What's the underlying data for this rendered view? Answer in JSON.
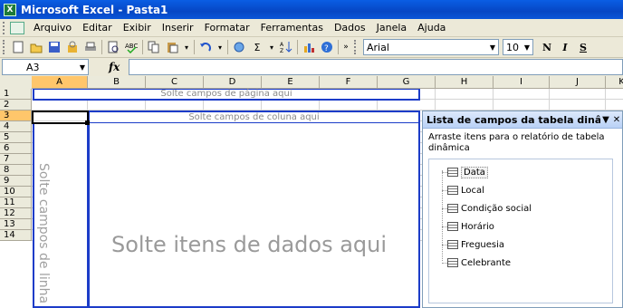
{
  "window": {
    "title": "Microsoft Excel - Pasta1"
  },
  "menubar": {
    "items": [
      {
        "label": "Arquivo"
      },
      {
        "label": "Editar"
      },
      {
        "label": "Exibir"
      },
      {
        "label": "Inserir"
      },
      {
        "label": "Formatar"
      },
      {
        "label": "Ferramentas"
      },
      {
        "label": "Dados"
      },
      {
        "label": "Janela"
      },
      {
        "label": "Ajuda"
      }
    ]
  },
  "toolbar": {
    "font_name": "Arial",
    "font_size": "10",
    "bold_label": "N",
    "italic_label": "I",
    "underline_label": "S",
    "sum_label": "Σ"
  },
  "formula_bar": {
    "name_box": "A3",
    "fx_label": "fx",
    "content": ""
  },
  "grid": {
    "columns": [
      "A",
      "B",
      "C",
      "D",
      "E",
      "F",
      "G",
      "H",
      "I",
      "J",
      "K"
    ],
    "selected_column": "A",
    "rows": [
      "1",
      "2",
      "3",
      "4",
      "5",
      "6",
      "7",
      "8",
      "9",
      "10",
      "11",
      "12",
      "13",
      "14"
    ],
    "selected_row": "3"
  },
  "pivot": {
    "page_drop": "Solte campos de página aqui",
    "column_drop": "Solte campos de coluna aqui",
    "row_drop": "Solte campos de linha",
    "data_drop": "Solte itens de dados aqui"
  },
  "field_list": {
    "title": "Lista de campos da tabela dinâmica",
    "description": "Arraste itens para o relatório de tabela dinâmica",
    "fields": [
      "Data",
      "Local",
      "Condição social",
      "Horário",
      "Freguesia",
      "Celebrante"
    ],
    "highlighted_field": "Data"
  },
  "colors": {
    "titlebar": "#0a5ee4",
    "drop_border": "#1c3cc8",
    "selection": "#ffc66b",
    "chrome": "#ece9d8"
  }
}
